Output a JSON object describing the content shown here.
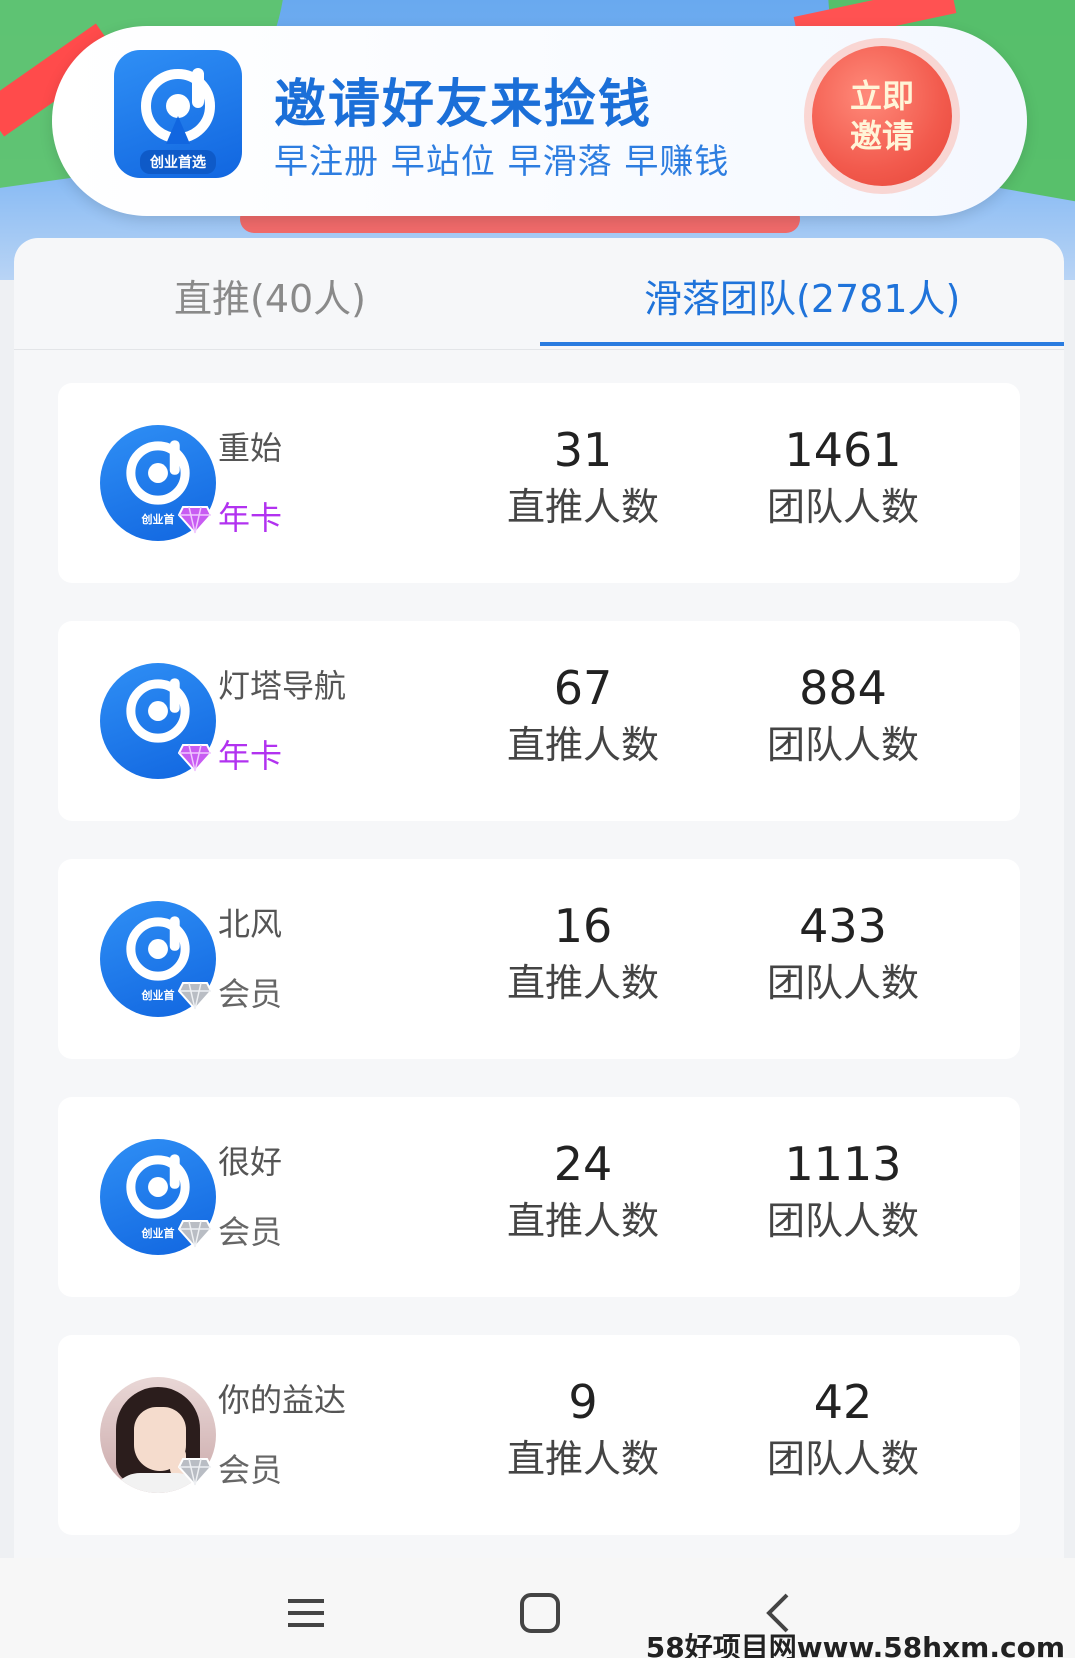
{
  "banner": {
    "logo_text": "创业首选",
    "title": "邀请好友来捡钱",
    "subtitle": "早注册 早站位 早滑落 早赚钱",
    "invite_line1": "立即",
    "invite_line2": "邀请",
    "colors": {
      "title": "#1b6fd8",
      "button": "#f25a4d"
    }
  },
  "tabs": [
    {
      "label": "直推(40人)",
      "active": false
    },
    {
      "label": "滑落团队(2781人)",
      "active": true
    }
  ],
  "labels": {
    "direct": "直推人数",
    "team": "团队人数"
  },
  "members": [
    {
      "name": "重始",
      "level": "年卡",
      "direct": "31",
      "team": "1461",
      "avatar": "app-logo",
      "avatar_text": "创业首"
    },
    {
      "name": "灯塔导航",
      "level": "年卡",
      "direct": "67",
      "team": "884",
      "avatar": "app-logo",
      "avatar_text": ""
    },
    {
      "name": "北风",
      "level": "会员",
      "direct": "16",
      "team": "433",
      "avatar": "app-logo",
      "avatar_text": "创业首"
    },
    {
      "name": "很好",
      "level": "会员",
      "direct": "24",
      "team": "1113",
      "avatar": "app-logo",
      "avatar_text": "创业首"
    },
    {
      "name": "你的益达",
      "level": "会员",
      "direct": "9",
      "team": "42",
      "avatar": "photo",
      "avatar_text": ""
    }
  ],
  "navbar": {
    "icons": [
      "menu-icon",
      "home-square-icon",
      "back-chevron-icon"
    ]
  },
  "watermark": "58好项目网www.58hxm.com"
}
